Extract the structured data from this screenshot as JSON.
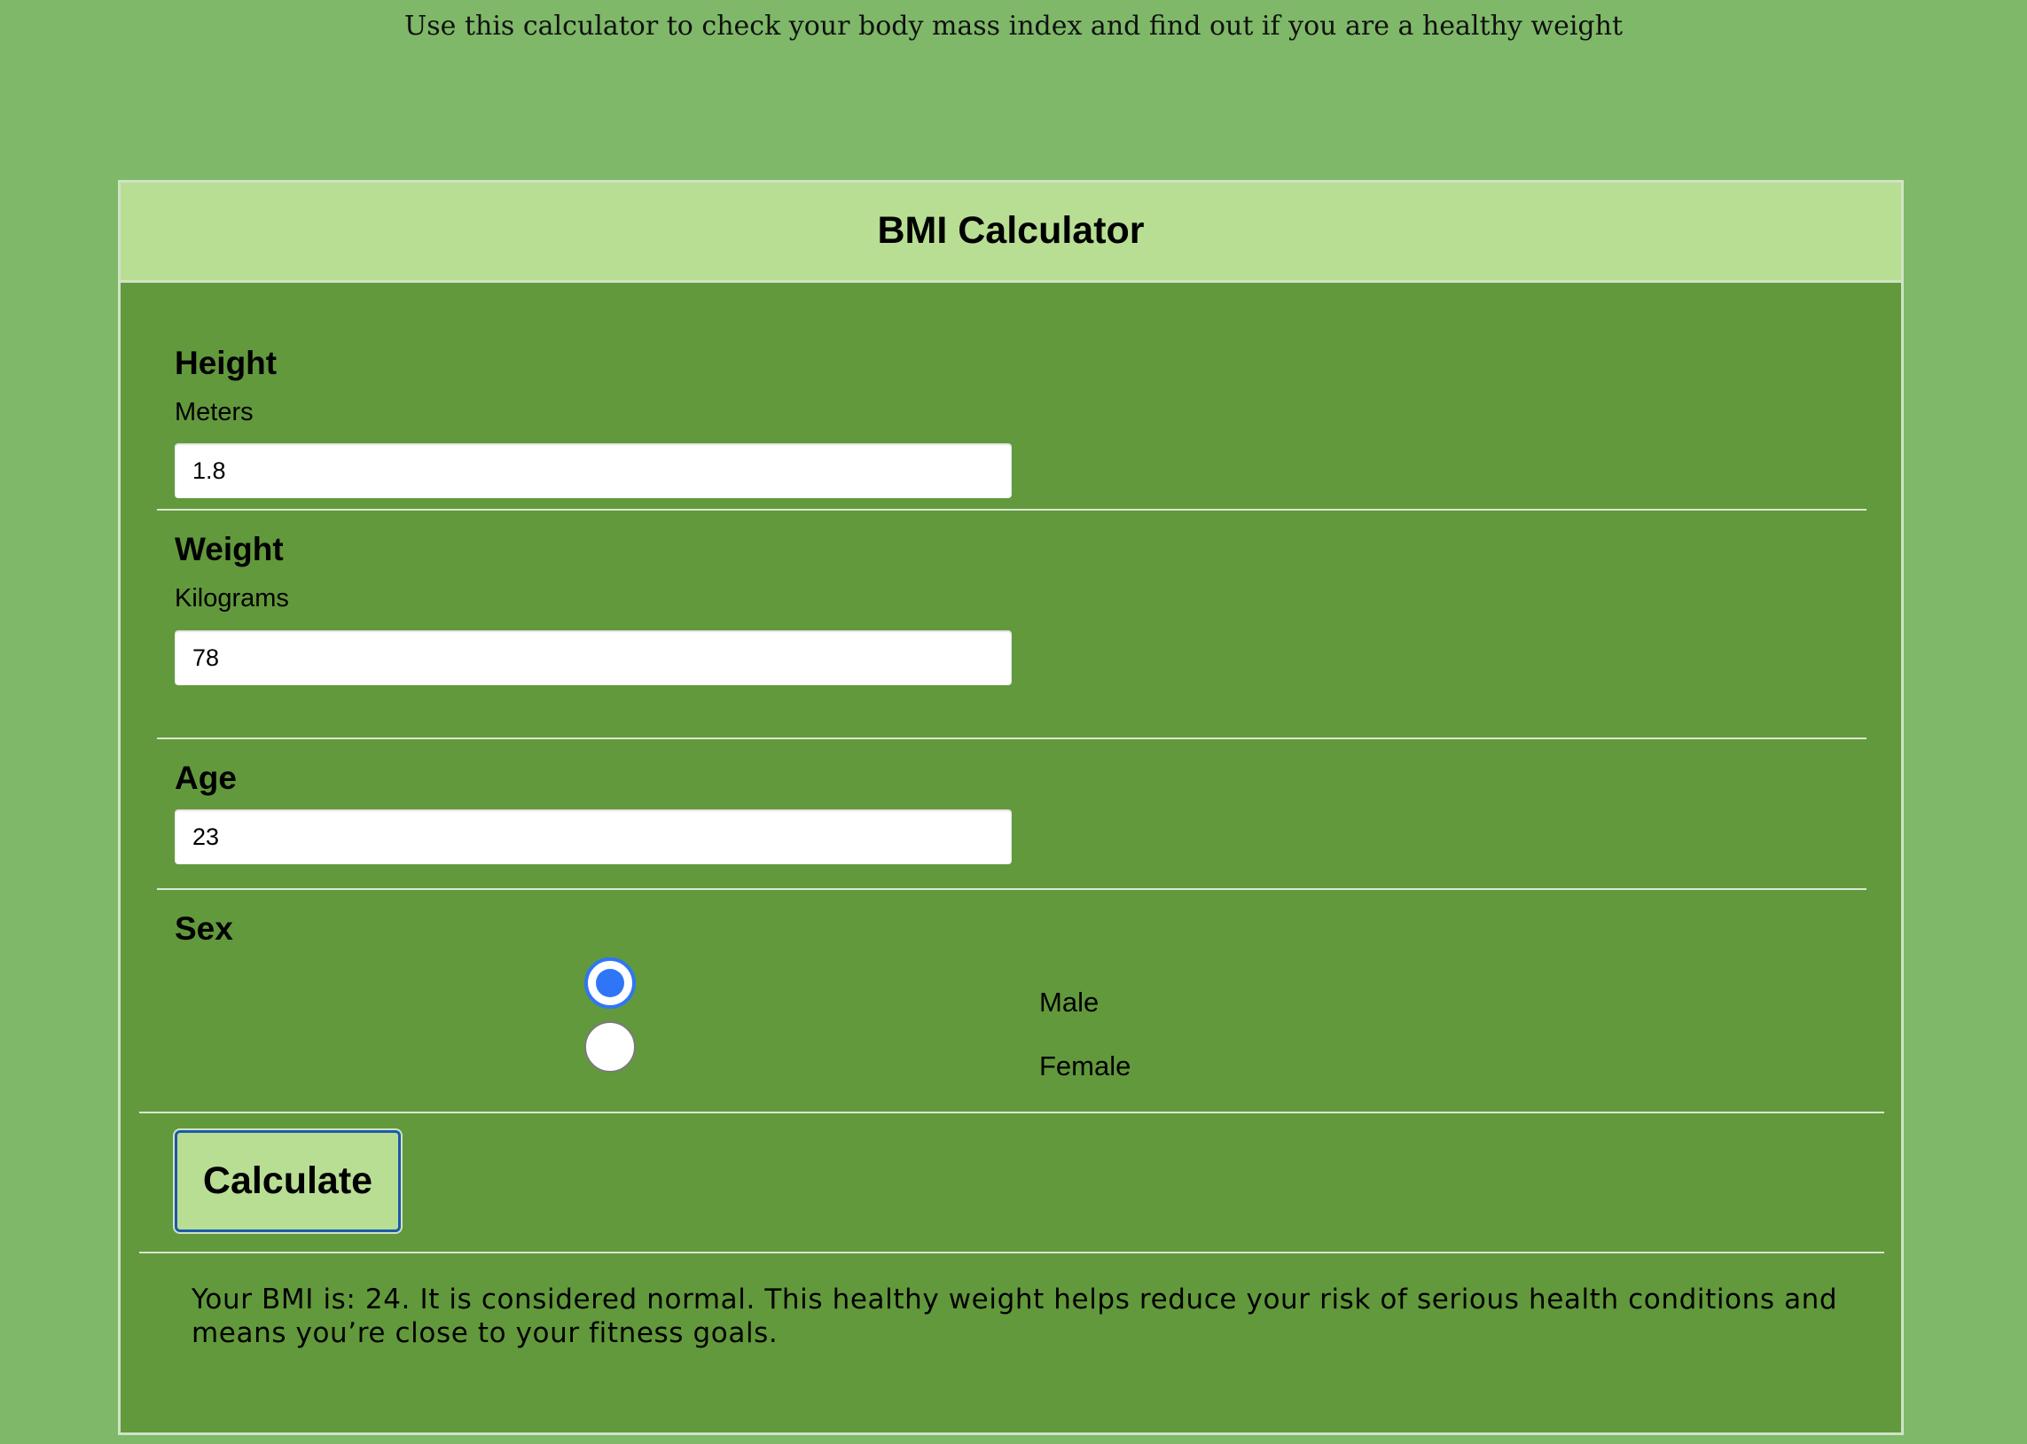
{
  "intro_text": "Use this calculator to check your body mass index and find out if you are a healthy weight",
  "calculator": {
    "title": "BMI Calculator",
    "height": {
      "label": "Height",
      "unit": "Meters",
      "value": "1.8"
    },
    "weight": {
      "label": "Weight",
      "unit": "Kilograms",
      "value": "78"
    },
    "age": {
      "label": "Age",
      "value": "23"
    },
    "sex": {
      "label": "Sex",
      "options": [
        {
          "label": "Male",
          "checked": true
        },
        {
          "label": "Female",
          "checked": false
        }
      ]
    },
    "calculate_label": "Calculate",
    "result_text": "Your BMI is: 24. It is considered normal. This healthy weight helps reduce your risk of serious health conditions and means you’re close to your fitness goals."
  },
  "colors": {
    "page_background": "#7eb868",
    "panel_background": "#62993c",
    "header_background": "#b8de94",
    "button_background": "#b8de94",
    "radio_accent": "#2f76f6"
  }
}
